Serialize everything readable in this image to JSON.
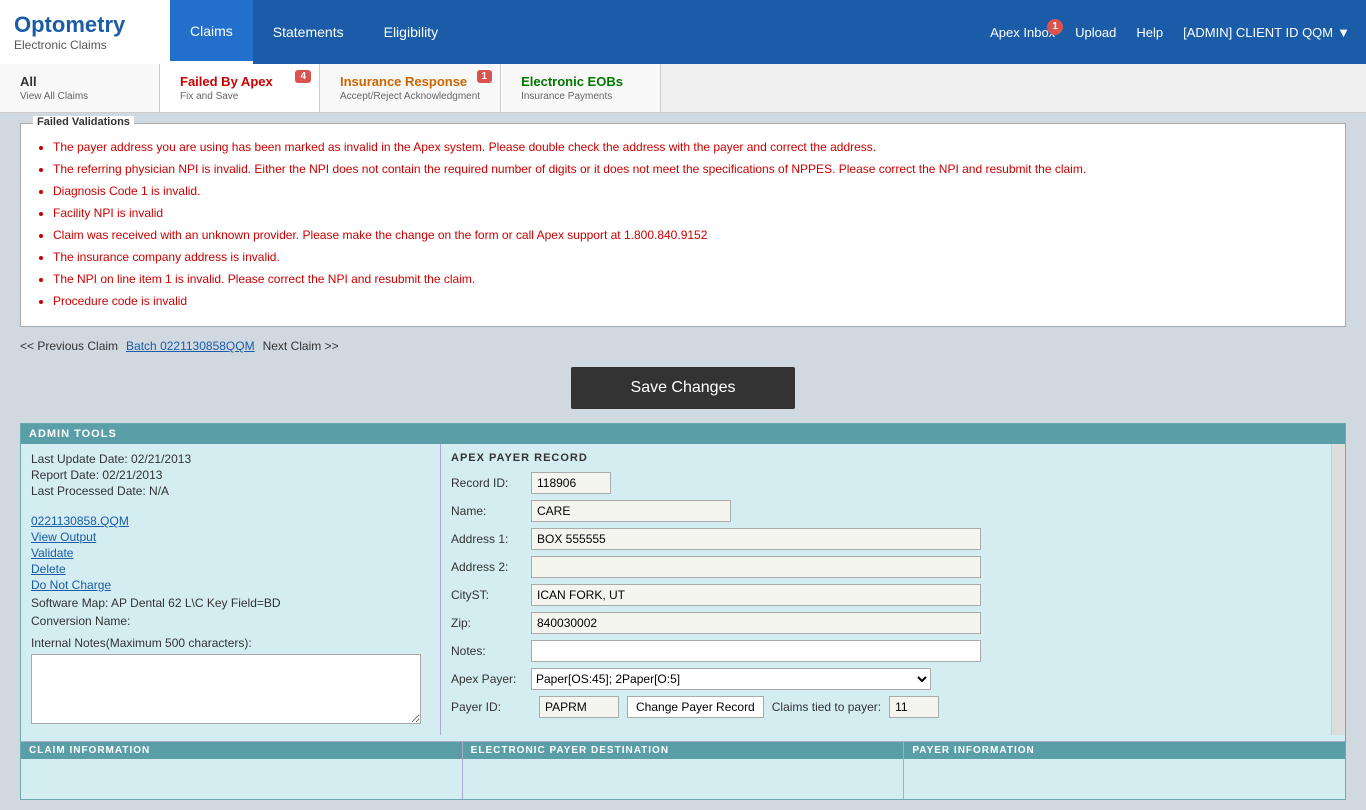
{
  "header": {
    "logo_title": "Optometry",
    "logo_sub": "Electronic Claims",
    "nav_items": [
      {
        "label": "Claims",
        "active": true
      },
      {
        "label": "Statements",
        "active": false
      },
      {
        "label": "Eligibility",
        "active": false
      }
    ],
    "apex_inbox_label": "Apex Inbox",
    "apex_inbox_badge": "1",
    "upload_label": "Upload",
    "help_label": "Help",
    "admin_label": "[ADMIN] CLIENT ID QQM"
  },
  "tabs": [
    {
      "label": "All",
      "sub": "View All Claims",
      "badge": null,
      "color": "all"
    },
    {
      "label": "Failed By Apex",
      "sub": "Fix and Save",
      "badge": "4",
      "color": "failed"
    },
    {
      "label": "Insurance Response",
      "sub": "Accept/Reject Acknowledgment",
      "badge": "1",
      "color": "insurance"
    },
    {
      "label": "Electronic EOBs",
      "sub": "Insurance Payments",
      "badge": null,
      "color": "eob"
    }
  ],
  "validations": {
    "title": "Failed Validations",
    "errors": [
      "The payer address you are using has been marked as invalid in the Apex system. Please double check the address with the payer and correct the address.",
      "The referring physician NPI is invalid. Either the NPI does not contain the required number of digits or it does not meet the specifications of NPPES. Please correct the NPI and resubmit the claim.",
      "Diagnosis Code 1 is invalid.",
      "Facility NPI is invalid",
      "Claim was received with an unknown provider. Please make the change on the form or call Apex support at 1.800.840.9152",
      "The insurance company address is invalid.",
      "The NPI on line item 1 is invalid. Please correct the NPI and resubmit the claim.",
      "Procedure code is invalid"
    ]
  },
  "navigation": {
    "prev": "<< Previous Claim",
    "batch": "Batch 0221130858QQM",
    "next": "Next Claim >>"
  },
  "save_button": "Save Changes",
  "admin_tools": {
    "header": "ADMIN TOOLS",
    "last_update": "Last Update Date: 02/21/2013",
    "report_date": "Report Date: 02/21/2013",
    "last_processed": "Last Processed Date: N/A",
    "links": [
      "0221130858.QQM",
      "View Output",
      "Validate",
      "Delete",
      "Do Not Charge"
    ],
    "software_map": "Software Map: AP Dental 62 L\\C Key Field=BD",
    "conversion_name": "Conversion Name:",
    "internal_notes_label": "Internal Notes(Maximum 500 characters):"
  },
  "apex_payer": {
    "header": "APEX PAYER RECORD",
    "record_id_label": "Record ID:",
    "record_id_value": "118906",
    "name_label": "Name:",
    "name_value": "CARE",
    "address1_label": "Address 1:",
    "address1_value": "BOX 555555",
    "address2_label": "Address 2:",
    "address2_value": "",
    "cityst_label": "CityST:",
    "cityst_value": "ICAN FORK, UT",
    "zip_label": "Zip:",
    "zip_value": "840030002",
    "notes_label": "Notes:",
    "notes_value": "",
    "apex_payer_label": "Apex Payer:",
    "apex_payer_value": "Paper[OS:45]; 2Paper[O:5]",
    "payer_id_label": "Payer ID:",
    "payer_id_value": "PAPRM",
    "change_payer_btn": "Change Payer Record",
    "claims_tied_label": "Claims tied to payer:",
    "claims_tied_value": "11"
  },
  "bottom_panels": [
    {
      "header": "CLAIM INFORMATION"
    },
    {
      "header": "ELECTRONIC PAYER DESTINATION"
    },
    {
      "header": "PAYER INFORMATION"
    }
  ]
}
